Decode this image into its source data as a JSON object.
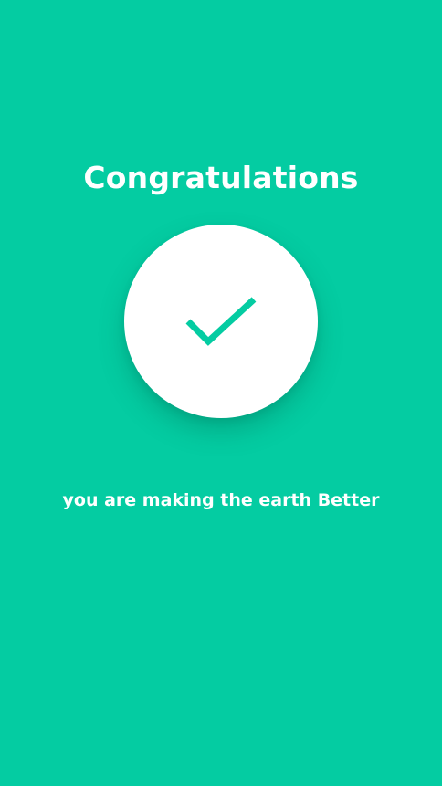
{
  "screen": {
    "title": "Congratulations",
    "subtitle": "you are making the earth Better",
    "icon": "check-icon"
  },
  "colors": {
    "background": "#04CCA2",
    "circle": "#FFFFFF",
    "check": "#04CCA2",
    "text": "#FFFFFF"
  }
}
